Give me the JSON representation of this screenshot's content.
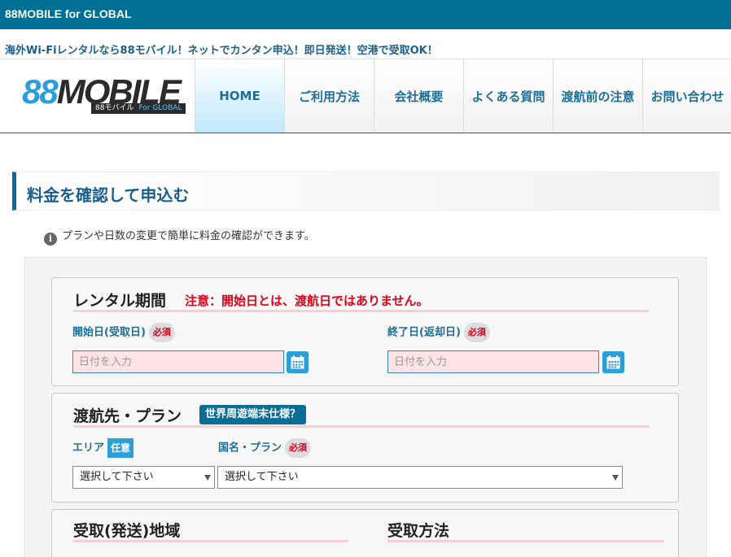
{
  "topbar": {
    "brand": "88MOBILE for GLOBAL"
  },
  "tagline": "海外Wi-Fiレンタルなら88モバイル！ネットでカンタン申込！即日発送！空港で受取OK！",
  "logo": {
    "num": "88",
    "word": "MOBILE",
    "sub_left": "88モバイル",
    "sub_right": "For GLOBAL"
  },
  "nav": {
    "items": [
      {
        "label": "HOME"
      },
      {
        "label": "ご利用方法"
      },
      {
        "label": "会社概要"
      },
      {
        "label": "よくある質問"
      },
      {
        "label": "渡航前の注意"
      },
      {
        "label": "お問い合わせ"
      }
    ]
  },
  "section": {
    "title": "料金を確認して申込む"
  },
  "info": {
    "icon": "i",
    "text": "プランや日数の変更で簡単に料金の確認ができます。"
  },
  "rental": {
    "title": "レンタル期間",
    "warning": "注意：開始日とは、渡航日ではありません。",
    "start_label": "開始日(受取日)",
    "end_label": "終了日(返却日)",
    "required": "必須",
    "date_placeholder": "日付を入力"
  },
  "destination": {
    "title": "渡航先・プラン",
    "badge": "世界周遊端末仕様？",
    "area_label": "エリア",
    "optional": "任意",
    "country_label": "国名・プラン",
    "required": "必須",
    "area_select": "選択して下さい",
    "country_select": "選択して下さい"
  },
  "pickup": {
    "region_title": "受取(発送)地域",
    "method_title": "受取方法"
  },
  "colors": {
    "primary": "#006f94",
    "accent": "#2d9fd8",
    "warning": "#e0001a",
    "input_bg": "#fde3e8",
    "underline": "#f8cdd6"
  }
}
